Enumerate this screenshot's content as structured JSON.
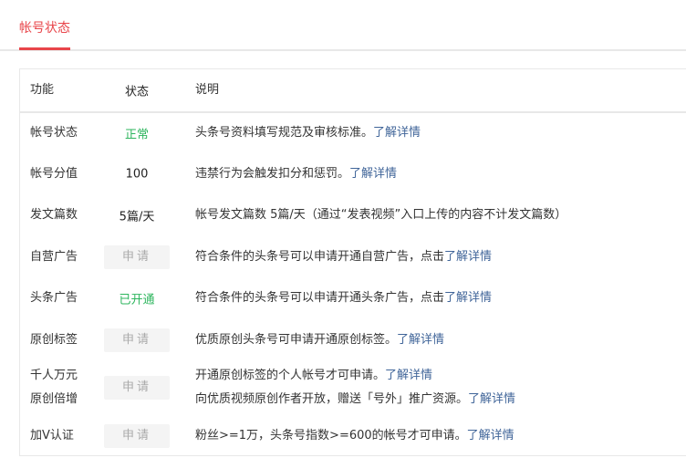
{
  "tab": {
    "label": "帐号状态"
  },
  "columns": [
    "功能",
    "状态",
    "说明"
  ],
  "rows": [
    {
      "feature": "帐号状态",
      "status": "正常",
      "status_type": "green",
      "lines": [
        {
          "text": "头条号资料填写规范及审核标准。",
          "link": "了解详情"
        }
      ]
    },
    {
      "feature": "帐号分值",
      "status": "100",
      "status_type": "text",
      "lines": [
        {
          "text": "违禁行为会触发扣分和惩罚。",
          "link": "了解详情"
        }
      ]
    },
    {
      "feature": "发文篇数",
      "status": "5篇/天",
      "status_type": "text",
      "lines": [
        {
          "text": "帐号发文篇数 5篇/天（通过“发表视频”入口上传的内容不计发文篇数）",
          "link": ""
        }
      ]
    },
    {
      "feature": "自营广告",
      "status": "申请",
      "status_type": "button",
      "lines": [
        {
          "text": "符合条件的头条号可以申请开通自营广告，点击",
          "link": "了解详情"
        }
      ]
    },
    {
      "feature": "头条广告",
      "status": "已开通",
      "status_type": "green",
      "lines": [
        {
          "text": "符合条件的头条号可以申请开通头条广告，点击",
          "link": "了解详情"
        }
      ]
    },
    {
      "feature": "原创标签",
      "status": "申请",
      "status_type": "button",
      "lines": [
        {
          "text": "优质原创头条号可申请开通原创标签。",
          "link": "了解详情"
        }
      ]
    },
    {
      "feature": "千人万元\n原创倍增",
      "status": "申请",
      "status_type": "button",
      "lines": [
        {
          "text": "开通原创标签的个人帐号才可申请。",
          "link": "了解详情"
        },
        {
          "text": "向优质视频原创作者开放，赠送「号外」推广资源。",
          "link": "了解详情"
        }
      ]
    },
    {
      "feature": "加V认证",
      "status": "申请",
      "status_type": "button",
      "lines": [
        {
          "text": "粉丝>=1万，头条号指数>=600的帐号才可申请。",
          "link": "了解详情"
        }
      ]
    }
  ]
}
